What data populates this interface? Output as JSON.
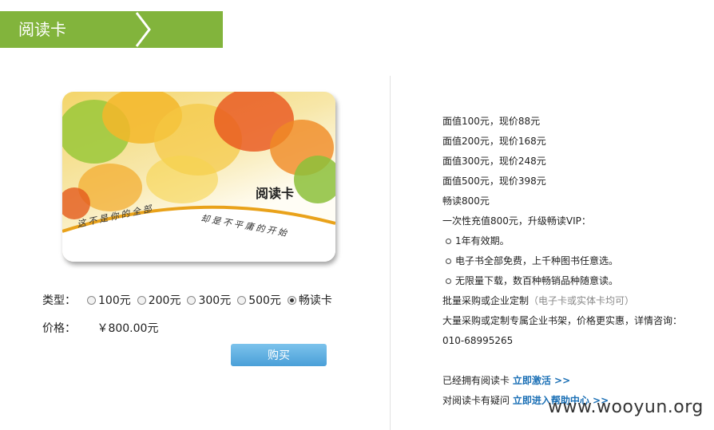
{
  "header": {
    "title": "阅读卡"
  },
  "card": {
    "name": "阅读卡",
    "slogan_left": "这不是你的全部",
    "slogan_right": "却是不平庸的开始"
  },
  "form": {
    "type_label": "类型：",
    "options": [
      {
        "label": "100元",
        "checked": false
      },
      {
        "label": "200元",
        "checked": false
      },
      {
        "label": "300元",
        "checked": false
      },
      {
        "label": "500元",
        "checked": false
      },
      {
        "label": "畅读卡",
        "checked": true
      }
    ],
    "price_label": "价格：",
    "price_value": "￥800.00元",
    "buy_label": "购买"
  },
  "info": {
    "lines": [
      "面值100元，现价88元",
      "面值200元，现价168元",
      "面值300元，现价248元",
      "面值500元，现价398元",
      "畅读800元",
      "一次性充值800元，升级畅读VIP："
    ],
    "bullets": [
      "1年有效期。",
      "电子书全部免费，上千种图书任意选。",
      "无限量下载，数百种畅销品种随意读。"
    ],
    "bulk_text": "批量采购或企业定制",
    "bulk_note": "（电子卡或实体卡均可）",
    "custom_text": "大量采购或定制专属企业书架，价格更实惠，详情咨询：",
    "phone": "010-68995265",
    "have_card_text": "已经拥有阅读卡",
    "activate_link": "立即激活 >>",
    "question_text": "对阅读卡有疑问",
    "help_link": "立即进入帮助中心 >>"
  },
  "watermark": "www.wooyun.org",
  "colors": {
    "header_green": "#82b43c",
    "button_blue": "#4a9fd8",
    "link_blue": "#1a6fb5"
  }
}
